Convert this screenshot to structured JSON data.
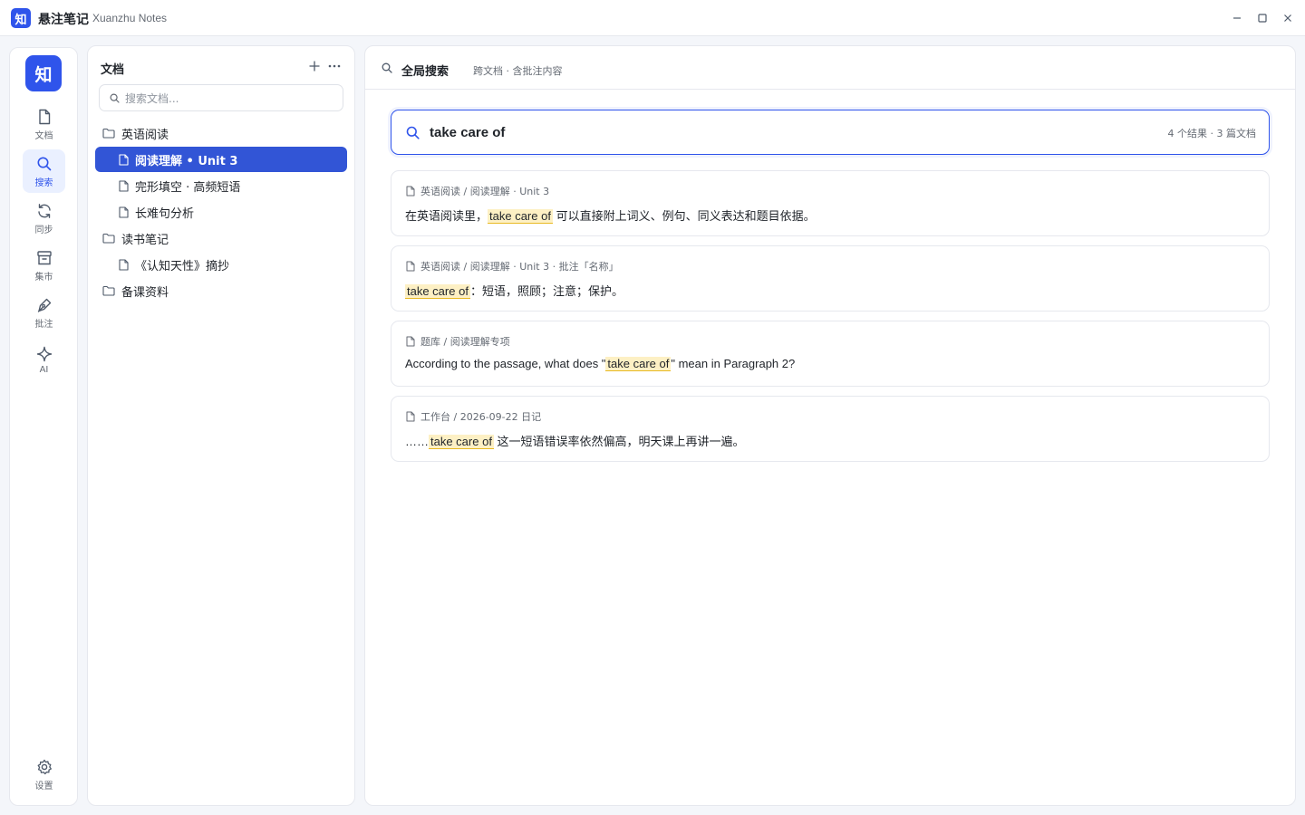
{
  "app": {
    "logo_char": "知",
    "title": "悬注笔记",
    "subtitle": "Xuanzhu Notes"
  },
  "window_controls": [
    "minimize",
    "maximize",
    "close"
  ],
  "rail": {
    "logo_char": "知",
    "items": [
      {
        "label": "文档",
        "icon": "file-icon",
        "active": false
      },
      {
        "label": "搜索",
        "icon": "search-icon",
        "active": true
      },
      {
        "label": "同步",
        "icon": "sync-icon",
        "active": false
      },
      {
        "label": "集市",
        "icon": "market-icon",
        "active": false
      },
      {
        "label": "批注",
        "icon": "pen-icon",
        "active": false
      },
      {
        "label": "AI",
        "icon": "sparkle-icon",
        "active": false
      }
    ],
    "settings_label": "设置"
  },
  "doc_panel": {
    "title": "文档",
    "search_placeholder": "搜索文档...",
    "tree": [
      {
        "type": "folder",
        "label": "英语阅读"
      },
      {
        "type": "file",
        "label": "阅读理解 • Unit 3",
        "active": true
      },
      {
        "type": "file",
        "label": "完形填空 · 高频短语"
      },
      {
        "type": "file",
        "label": "长难句分析"
      },
      {
        "type": "folder",
        "label": "读书笔记"
      },
      {
        "type": "file",
        "label": "《认知天性》摘抄"
      },
      {
        "type": "folder",
        "label": "备课资料"
      }
    ]
  },
  "main": {
    "title": "全局搜索",
    "subtitle": "跨文档 · 含批注内容",
    "query": "take care of",
    "result_count": "4 个结果 · 3 篇文档",
    "results": [
      {
        "path": "英语阅读 / 阅读理解 · Unit 3",
        "before": "在英语阅读里，",
        "highlight": "take care of",
        "after": " 可以直接附上词义、例句、同义表达和题目依据。"
      },
      {
        "path": "英语阅读 / 阅读理解 · Unit 3 · 批注「名称」",
        "before": "",
        "highlight": "take care of",
        "after": "：短语，照顾；注意；保护。"
      },
      {
        "path": "题库 / 阅读理解专项",
        "before": "According to the passage, what does \"",
        "highlight": "take care of",
        "after": "\" mean in Paragraph 2?"
      },
      {
        "path": "工作台 / 2026-09-22 日记",
        "before": "……",
        "highlight": "take care of",
        "after": " 这一短语错误率依然偏高，明天课上再讲一遍。"
      }
    ]
  },
  "colors": {
    "accent": "#2f54eb",
    "highlight": "#fdf0c4"
  }
}
